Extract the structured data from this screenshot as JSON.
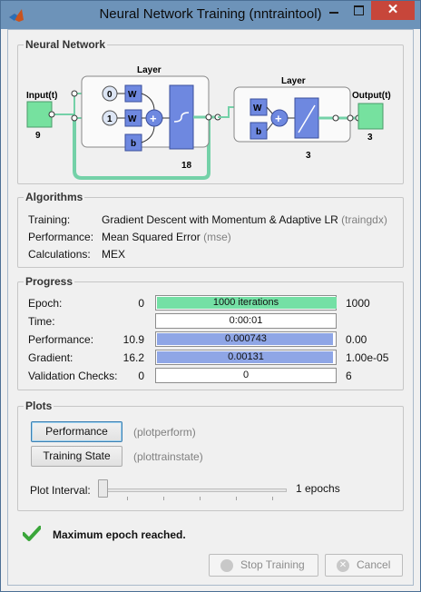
{
  "window": {
    "title": "Neural Network Training (nntraintool)",
    "close_glyph": "✕"
  },
  "neural_network": {
    "section_title": "Neural Network",
    "input_label": "Input(t)",
    "input_size": "9",
    "hidden_layer_label": "Layer",
    "hidden_size": "18",
    "delay_top": "0",
    "delay_bottom": "1",
    "weight_label": "W",
    "bias_label": "b",
    "output_layer_label": "Layer",
    "output_size": "3",
    "output_label": "Output(t)",
    "output_value": "3"
  },
  "algorithms": {
    "section_title": "Algorithms",
    "rows": [
      {
        "label": "Training:",
        "value": "Gradient Descent with Momentum & Adaptive LR",
        "fn": "(traingdx)"
      },
      {
        "label": "Performance:",
        "value": "Mean Squared Error",
        "fn": "(mse)"
      },
      {
        "label": "Calculations:",
        "value": "MEX",
        "fn": ""
      }
    ]
  },
  "progress": {
    "section_title": "Progress",
    "rows": [
      {
        "label": "Epoch:",
        "start": "0",
        "current": "1000 iterations",
        "end": "1000",
        "fill_fraction": 1.0,
        "fill_color": "#74e0a5"
      },
      {
        "label": "Time:",
        "start": "",
        "current": "0:00:01",
        "end": "",
        "fill_fraction": 0,
        "fill_color": "#ffffff"
      },
      {
        "label": "Performance:",
        "start": "10.9",
        "current": "0.000743",
        "end": "0.00",
        "fill_fraction": 0.98,
        "fill_color": "#8fa6e6"
      },
      {
        "label": "Gradient:",
        "start": "16.2",
        "current": "0.00131",
        "end": "1.00e-05",
        "fill_fraction": 0.98,
        "fill_color": "#8fa6e6"
      },
      {
        "label": "Validation Checks:",
        "start": "0",
        "current": "0",
        "end": "6",
        "fill_fraction": 0,
        "fill_color": "#ffffff"
      }
    ]
  },
  "plots": {
    "section_title": "Plots",
    "buttons": [
      {
        "label": "Performance",
        "fn": "(plotperform)"
      },
      {
        "label": "Training State",
        "fn": "(plottrainstate)"
      }
    ],
    "interval_label": "Plot Interval:",
    "interval_value": "1 epochs"
  },
  "status": {
    "message": "Maximum epoch reached.",
    "check_color": "#3aa63a"
  },
  "footer": {
    "stop_label": "Stop Training",
    "cancel_label": "Cancel"
  },
  "colors": {
    "accent_green": "#74e0a5",
    "accent_blue": "#8fa6e6",
    "titlebar": "#6d93b9",
    "close": "#c7463a"
  }
}
